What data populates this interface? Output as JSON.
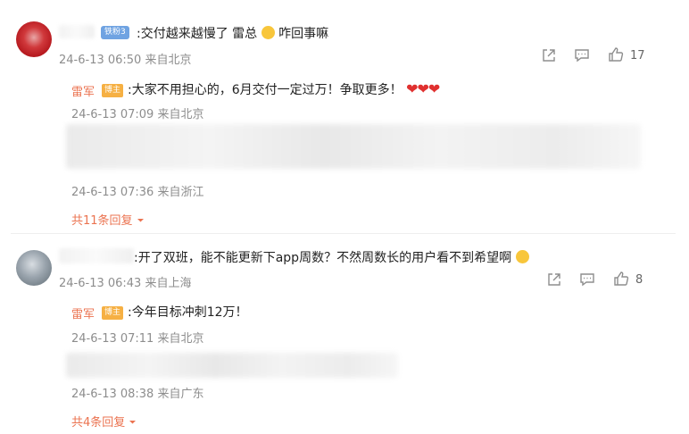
{
  "comment1": {
    "badge": "铁粉3",
    "text": ":交付越来越慢了 雷总",
    "text_suffix": "咋回事嘛",
    "meta": "24-6-13 06:50 来自北京",
    "likes": "17",
    "reply1": {
      "name": "雷军",
      "badge": "博主",
      "text": ":大家不用担心的，6月交付一定过万！争取更多！",
      "hearts": "❤❤❤",
      "meta": "24-6-13 07:09 来自北京"
    },
    "reply2_meta": "24-6-13 07:36 来自浙江",
    "more_label": "共11条回复"
  },
  "comment2": {
    "text": ":开了双班，能不能更新下app周数？不然周数长的用户看不到希望啊",
    "meta": "24-6-13 06:43 来自上海",
    "likes": "8",
    "reply1": {
      "name": "雷军",
      "badge": "博主",
      "text": ":今年目标冲刺12万！",
      "meta": "24-6-13 07:11 来自北京"
    },
    "reply2_meta": "24-6-13 08:38 来自广东",
    "more_label": "共4条回复"
  },
  "icons": [
    "share-icon",
    "comment-icon",
    "like-icon",
    "chevron-down-icon"
  ]
}
